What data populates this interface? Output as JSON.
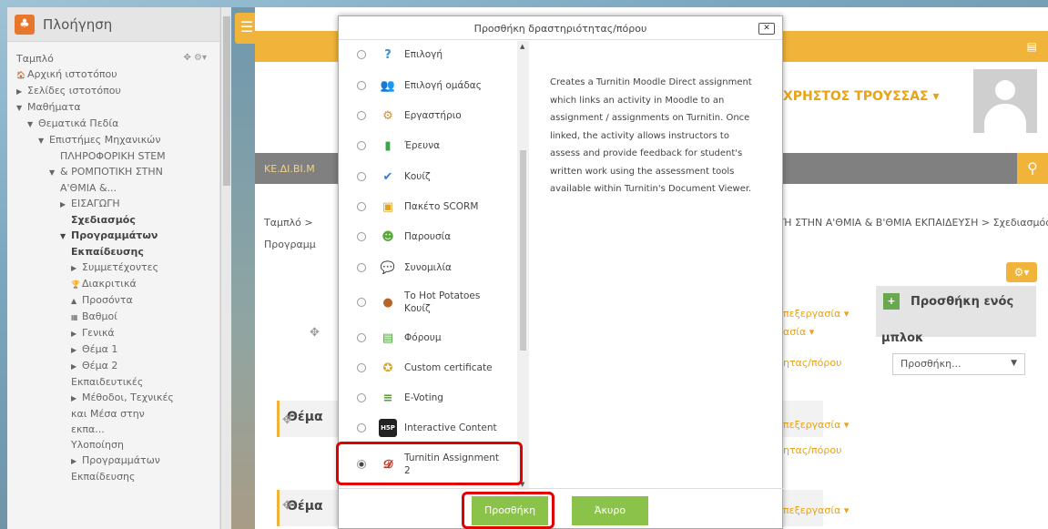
{
  "sidebar": {
    "title": "Πλοήγηση",
    "items": [
      {
        "label": "Ταμπλό",
        "indent": 0,
        "bold": false,
        "prefix": ""
      },
      {
        "label": "Αρχική ιστοτόπου",
        "indent": 0,
        "bold": false,
        "prefix": "🏠"
      },
      {
        "label": "Σελίδες ιστοτόπου",
        "indent": 0,
        "bold": false,
        "prefix": "▶"
      },
      {
        "label": "Μαθήματα",
        "indent": 0,
        "bold": false,
        "prefix": "▼"
      },
      {
        "label": "Θεματικά Πεδία",
        "indent": 1,
        "bold": false,
        "prefix": "▼"
      },
      {
        "label": "Επιστήμες Μηχανικών",
        "indent": 2,
        "bold": false,
        "prefix": "▼"
      },
      {
        "label": "ΠΛΗΡΟΦΟΡΙΚΗ STEM",
        "indent": 4,
        "bold": false,
        "prefix": ""
      },
      {
        "label": "& ΡΟΜΠΟΤΙΚΗ ΣΤΗΝ",
        "indent": 3,
        "bold": false,
        "prefix": "▼"
      },
      {
        "label": "Α'ΘΜΙΑ &...",
        "indent": 4,
        "bold": false,
        "prefix": ""
      },
      {
        "label": "ΕΙΣΑΓΩΓΗ",
        "indent": 4,
        "bold": false,
        "prefix": "▶"
      },
      {
        "label": "Σχεδιασμός",
        "indent": 5,
        "bold": true,
        "prefix": ""
      },
      {
        "label": "Προγραμμάτων",
        "indent": 4,
        "bold": true,
        "prefix": "▼"
      },
      {
        "label": "Εκπαίδευσης",
        "indent": 5,
        "bold": true,
        "prefix": ""
      },
      {
        "label": "Συμμετέχοντες",
        "indent": 5,
        "bold": false,
        "prefix": "▶"
      },
      {
        "label": "Διακριτικά",
        "indent": 5,
        "bold": false,
        "prefix": "🏆"
      },
      {
        "label": "Προσόντα",
        "indent": 5,
        "bold": false,
        "prefix": "▲"
      },
      {
        "label": "Βαθμοί",
        "indent": 5,
        "bold": false,
        "prefix": "▦"
      },
      {
        "label": "Γενικά",
        "indent": 5,
        "bold": false,
        "prefix": "▶"
      },
      {
        "label": "Θέμα 1",
        "indent": 5,
        "bold": false,
        "prefix": "▶"
      },
      {
        "label": "Θέμα 2",
        "indent": 5,
        "bold": false,
        "prefix": "▶"
      },
      {
        "label": "Εκπαιδευτικές",
        "indent": 5,
        "bold": false,
        "prefix": ""
      },
      {
        "label": "Μέθοδοι, Τεχνικές",
        "indent": 5,
        "bold": false,
        "prefix": "▶"
      },
      {
        "label": "και Μέσα στην",
        "indent": 5,
        "bold": false,
        "prefix": ""
      },
      {
        "label": "εκπα...",
        "indent": 5,
        "bold": false,
        "prefix": ""
      },
      {
        "label": "Υλοποίηση",
        "indent": 5,
        "bold": false,
        "prefix": ""
      },
      {
        "label": "Προγραμμάτων",
        "indent": 5,
        "bold": false,
        "prefix": "▶"
      },
      {
        "label": "Εκπαίδευσης",
        "indent": 5,
        "bold": false,
        "prefix": ""
      }
    ]
  },
  "page": {
    "user_name": "ΧΡΗΣΤΟΣ ΤΡΟΥΣΣΑΣ ▾",
    "nav_label": "ΚΕ.ΔΙ.ΒΙ.Μ",
    "crumb_start": "Ταμπλό >",
    "crumb_end": "Ή ΣΤΗΝ Α'ΘΜΙΑ & Β'ΘΜΙΑ ΕΚΠΑΙΔΕΥΣΗ > Σχεδιασμός",
    "crumb_line2": "Προγραμμ",
    "add_block_title": "Προσθήκη ενός",
    "add_block_title2": "μπλοκ",
    "add_block_select": "Προσθήκη...",
    "edit_label": "πεξεργασία ▾",
    "edit_label2": "ασία ▾",
    "activity_label": "ητας/πόρου",
    "section_label": "Θέμα"
  },
  "modal": {
    "title": "Προσθήκη δραστηριότητας/πόρου",
    "close_label": "✕",
    "activities": [
      {
        "label": "Επιλογή",
        "icon": "question-icon",
        "color": "#3a8fd6",
        "glyph": "?",
        "selected": false
      },
      {
        "label": "Επιλογή ομάδας",
        "icon": "group-icon",
        "color": "#e07b1f",
        "glyph": "👥",
        "selected": false
      },
      {
        "label": "Εργαστήριο",
        "icon": "workshop-icon",
        "color": "#e08a2a",
        "glyph": "⚙",
        "selected": false
      },
      {
        "label": "Έρευνα",
        "icon": "survey-chart-icon",
        "color": "#3aa54a",
        "glyph": "▮",
        "selected": false
      },
      {
        "label": "Κουίζ",
        "icon": "quiz-check-icon",
        "color": "#3a7bd6",
        "glyph": "✔",
        "selected": false
      },
      {
        "label": "Πακέτο SCORM",
        "icon": "scorm-package-icon",
        "color": "#e0a321",
        "glyph": "▣",
        "selected": false
      },
      {
        "label": "Παρουσία",
        "icon": "attendance-icon",
        "color": "#5aa83a",
        "glyph": "☻",
        "selected": false
      },
      {
        "label": "Συνομιλία",
        "icon": "chat-bubble-icon",
        "color": "#4a90d9",
        "glyph": "💬",
        "selected": false
      },
      {
        "label": "Το Hot Potatoes Κουίζ",
        "icon": "hot-potatoes-icon",
        "color": "#b5652a",
        "glyph": "●",
        "selected": false
      },
      {
        "label": "Φόρουμ",
        "icon": "forum-icon",
        "color": "#4aa03a",
        "glyph": "▤",
        "selected": false
      },
      {
        "label": "Custom certificate",
        "icon": "certificate-icon",
        "color": "#d9a520",
        "glyph": "✪",
        "selected": false
      },
      {
        "label": "E-Voting",
        "icon": "voting-bars-icon",
        "color": "#5a9a3a",
        "glyph": "≡",
        "selected": false
      },
      {
        "label": "Interactive Content",
        "icon": "h5p-icon",
        "color": "#222222",
        "glyph": "H5P",
        "selected": false
      },
      {
        "label": "Turnitin Assignment 2",
        "icon": "turnitin-icon",
        "color": "#c0392b",
        "glyph": "𝓓",
        "selected": true
      }
    ],
    "description": "Creates a Turnitin Moodle Direct assignment which links an activity in Moodle to an assignment / assignments on Turnitin. Once linked, the activity allows instructors to assess and provide feedback for student's written work using the assessment tools available within Turnitin's Document Viewer.",
    "add_button": "Προσθήκη",
    "cancel_button": "Άκυρο"
  }
}
